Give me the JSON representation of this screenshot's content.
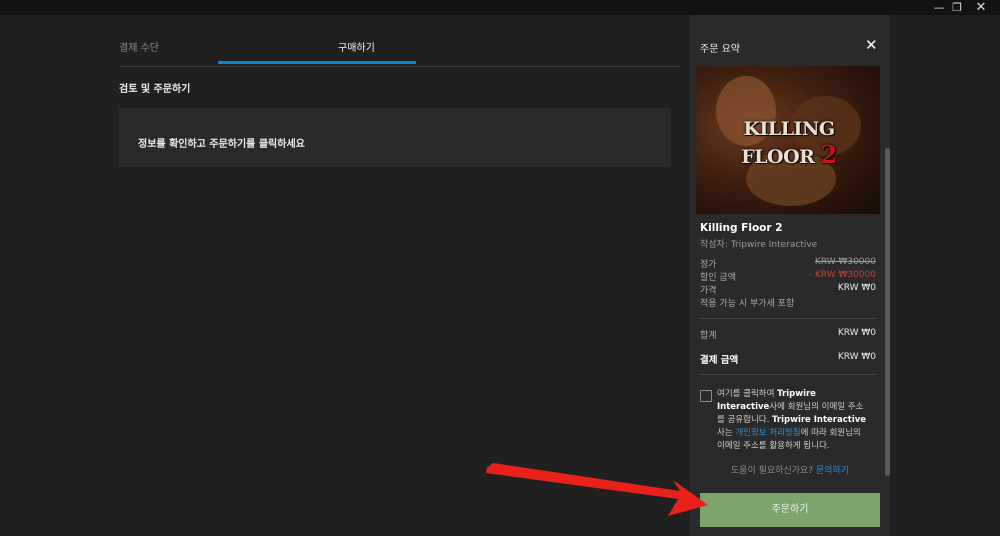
{
  "window": {
    "minimize_glyph": "—",
    "maximize_glyph": "❐",
    "close_glyph": "✕"
  },
  "checkout": {
    "tabs": [
      {
        "label": "결제 수단",
        "active": false
      },
      {
        "label": "구매하기",
        "active": true
      }
    ],
    "section_title": "검토 및 주문하기",
    "info_text": "정보를 확인하고 주문하기를 클릭하세요",
    "accent_color": "#0a84d8"
  },
  "summary": {
    "title": "주문 요약",
    "close_glyph": "✕",
    "cover_logo_text": "KILLING FLOOR",
    "cover_logo_number": "2",
    "game_name": "Killing Floor 2",
    "publisher_label": "작성자:",
    "publisher": "Tripwire Interactive",
    "rows": {
      "list_price_label": "정가",
      "list_price": "KRW ₩30000",
      "discount_label": "할인 금액",
      "discount": "- KRW ₩30000",
      "price_label": "가격",
      "price": "KRW ₩0",
      "tax_note": "적용 가능 시 부가세 포함"
    },
    "total_label": "합계",
    "total": "KRW ₩0",
    "payment_label": "결제 금액",
    "payment": "KRW ₩0",
    "consent": {
      "part1": "여기를 클릭하여 ",
      "company1": "Tripwire Interactive",
      "part2": "사에 회원님의 이메일 주소를 공유합니다. ",
      "company2": "Tripwire Interactive",
      "part3": "사는 ",
      "privacy_link": "개인정보 처리방침",
      "part4": "에 따라 회원님의 이메일 주소를 활용하게 됩니다."
    },
    "help_text": "도움이 필요하신가요?",
    "help_link": "문의하기",
    "order_button": "주문하기",
    "order_button_color": "#7da46a"
  },
  "annotation": {
    "arrow_color": "#e8221b"
  }
}
